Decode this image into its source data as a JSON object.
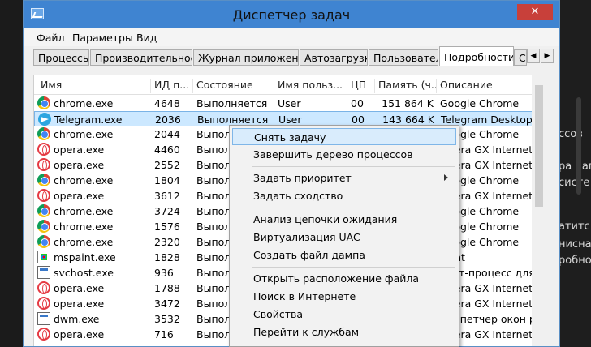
{
  "window": {
    "title": "Диспетчер задач",
    "close_glyph": "✕"
  },
  "menu": [
    "Файл",
    "Параметры",
    "Вид"
  ],
  "tabs": [
    {
      "label": "Процессы",
      "active": false
    },
    {
      "label": "Производительность",
      "active": false
    },
    {
      "label": "Журнал приложений",
      "active": false
    },
    {
      "label": "Автозагрузка",
      "active": false
    },
    {
      "label": "Пользователи",
      "active": false
    },
    {
      "label": "Подробности",
      "active": true
    },
    {
      "label": "С",
      "active": false
    }
  ],
  "tab_scroll": {
    "left": "◀",
    "right": "▶"
  },
  "columns": [
    "Имя",
    "ИД п...",
    "Состояние",
    "Имя польз...",
    "ЦП",
    "Память (ч...",
    "Описание"
  ],
  "rows": [
    {
      "icon": "chrome-icon",
      "name": "chrome.exe",
      "pid": "4648",
      "state": "Выполняется",
      "user": "User",
      "cpu": "00",
      "mem": "151 864 K",
      "desc": "Google Chrome"
    },
    {
      "icon": "telegram-icon",
      "name": "Telegram.exe",
      "pid": "2036",
      "state": "Выполняется",
      "user": "User",
      "cpu": "00",
      "mem": "143 664 K",
      "desc": "Telegram Desktop",
      "selected": true
    },
    {
      "icon": "chrome-icon",
      "name": "chrome.exe",
      "pid": "2044",
      "state": "Выпол",
      "desc": "Google Chrome"
    },
    {
      "icon": "opera-icon",
      "name": "opera.exe",
      "pid": "4460",
      "state": "Выпол",
      "desc": "Opera GX Internet Br..."
    },
    {
      "icon": "opera-icon",
      "name": "opera.exe",
      "pid": "2552",
      "state": "Выпол",
      "desc": "Opera GX Internet Br..."
    },
    {
      "icon": "chrome-icon",
      "name": "chrome.exe",
      "pid": "1804",
      "state": "Выпол",
      "desc": "Google Chrome"
    },
    {
      "icon": "opera-icon",
      "name": "opera.exe",
      "pid": "3612",
      "state": "Выпол",
      "desc": "Opera GX Internet Br..."
    },
    {
      "icon": "chrome-icon",
      "name": "chrome.exe",
      "pid": "3724",
      "state": "Выпол",
      "desc": "Google Chrome"
    },
    {
      "icon": "chrome-icon",
      "name": "chrome.exe",
      "pid": "1576",
      "state": "Выпол",
      "desc": "Google Chrome"
    },
    {
      "icon": "chrome-icon",
      "name": "chrome.exe",
      "pid": "2320",
      "state": "Выпол",
      "desc": "Google Chrome"
    },
    {
      "icon": "paint-icon",
      "name": "mspaint.exe",
      "pid": "1828",
      "state": "Выпол",
      "desc": "Paint"
    },
    {
      "icon": "generic-app-icon",
      "name": "svchost.exe",
      "pid": "936",
      "state": "Выпол",
      "desc": "Хост-процесс для с..."
    },
    {
      "icon": "opera-icon",
      "name": "opera.exe",
      "pid": "1788",
      "state": "Выпол",
      "desc": "Opera GX Internet Br..."
    },
    {
      "icon": "opera-icon",
      "name": "opera.exe",
      "pid": "3472",
      "state": "Выпол",
      "desc": "Opera GX Internet Br..."
    },
    {
      "icon": "generic-app-icon",
      "name": "dwm.exe",
      "pid": "3532",
      "state": "Выпол",
      "desc": "Диспетчер окон ра..."
    },
    {
      "icon": "opera-icon",
      "name": "opera.exe",
      "pid": "716",
      "state": "Выпол",
      "desc": "Opera GX Internet Br..."
    }
  ],
  "context_menu": [
    {
      "label": "Снять задачу",
      "highlighted": true
    },
    {
      "label": "Завершить дерево процессов"
    },
    {
      "sep": true
    },
    {
      "label": "Задать приоритет",
      "submenu": true
    },
    {
      "label": "Задать сходство"
    },
    {
      "sep": true
    },
    {
      "label": "Анализ цепочки ожидания"
    },
    {
      "label": "Виртуализация UAC"
    },
    {
      "label": "Создать файл дампа"
    },
    {
      "sep": true
    },
    {
      "label": "Открыть расположение файла"
    },
    {
      "label": "Поиск в Интернете"
    },
    {
      "label": "Свойства"
    },
    {
      "label": "Перейти к службам"
    }
  ],
  "background_text": [
    "ссов",
    "ра нап",
    "систе",
    "атится",
    "нисна",
    "робнос"
  ]
}
